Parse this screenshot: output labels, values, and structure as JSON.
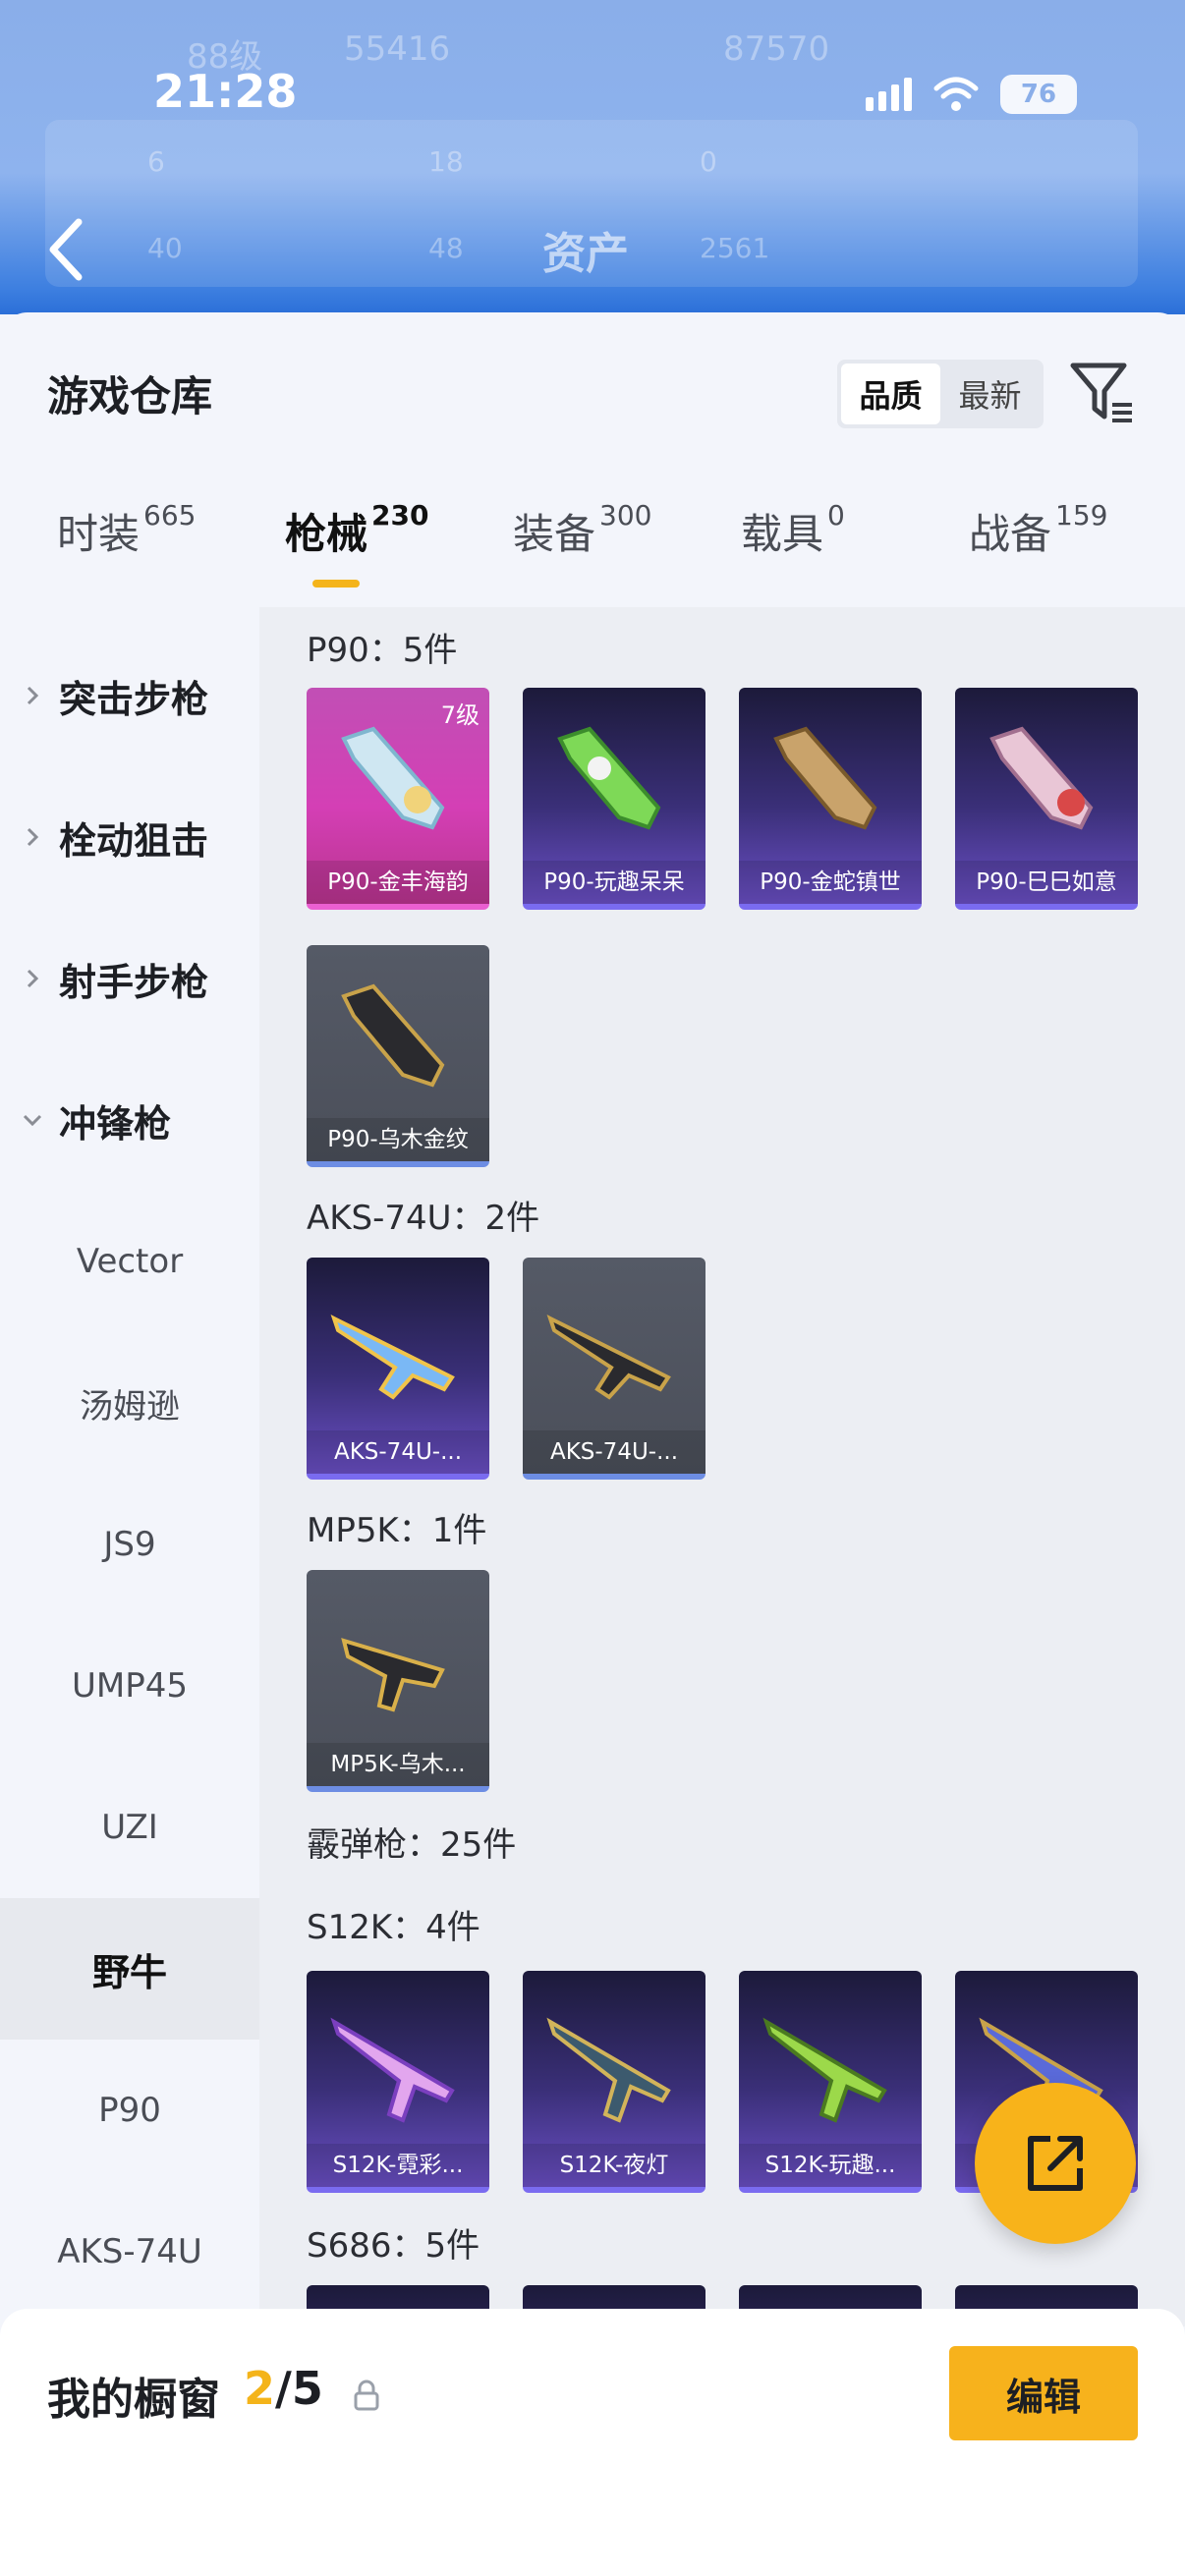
{
  "status_bar": {
    "time": "21:28",
    "battery": "76"
  },
  "header": {
    "title": "资产",
    "ghost_texts": [
      "88级",
      "55416",
      "87570",
      "6",
      "18",
      "0",
      "40",
      "48",
      "2561"
    ]
  },
  "warehouse": {
    "title": "游戏仓库",
    "sort_options": [
      "品质",
      "最新"
    ],
    "active_sort": "品质"
  },
  "tabs": [
    {
      "label": "时装",
      "count": "665"
    },
    {
      "label": "枪械",
      "count": "230"
    },
    {
      "label": "装备",
      "count": "300"
    },
    {
      "label": "载具",
      "count": "0"
    },
    {
      "label": "战备",
      "count": "159"
    }
  ],
  "sidebar": {
    "categories": [
      {
        "label": "突击步枪"
      },
      {
        "label": "栓动狙击"
      },
      {
        "label": "射手步枪"
      },
      {
        "label": "冲锋枪"
      }
    ],
    "subitems": [
      "Vector",
      "汤姆逊",
      "JS9",
      "UMP45",
      "UZI",
      "野牛",
      "P90",
      "AKS-74U"
    ]
  },
  "sections": [
    {
      "title": "P90：5件",
      "items": [
        {
          "name": "P90-金丰海韵",
          "level": "7级",
          "rarity": "pink"
        },
        {
          "name": "P90-玩趣呆呆",
          "rarity": "purple"
        },
        {
          "name": "P90-金蛇镇世",
          "rarity": "purple"
        },
        {
          "name": "P90-巳巳如意",
          "rarity": "purple"
        },
        {
          "name": "P90-乌木金纹",
          "rarity": "gray"
        }
      ]
    },
    {
      "title": "AKS-74U：2件",
      "items": [
        {
          "name": "AKS-74U-...",
          "rarity": "purple"
        },
        {
          "name": "AKS-74U-...",
          "rarity": "gray"
        }
      ]
    },
    {
      "title": "MP5K：1件",
      "items": [
        {
          "name": "MP5K-乌木...",
          "rarity": "gray"
        }
      ]
    },
    {
      "title": "霰弹枪：25件"
    },
    {
      "title": "S12K：4件",
      "items": [
        {
          "name": "S12K-霓彩...",
          "rarity": "purple"
        },
        {
          "name": "S12K-夜灯",
          "rarity": "purple"
        },
        {
          "name": "S12K-玩趣...",
          "rarity": "purple"
        },
        {
          "name": "",
          "rarity": "purple"
        }
      ]
    },
    {
      "title": "S686：5件"
    }
  ],
  "showcase": {
    "label": "我的橱窗",
    "current": "2",
    "total": "/5",
    "edit_label": "编辑"
  }
}
